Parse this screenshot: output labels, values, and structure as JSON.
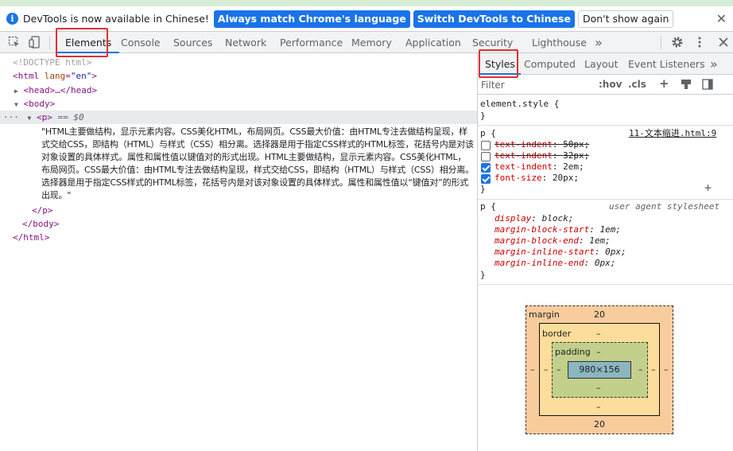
{
  "banner": {
    "message": "DevTools is now available in Chinese!",
    "match_language_label": "Always match Chrome's language",
    "switch_label": "Switch DevTools to Chinese",
    "dont_show_label": "Don't show again",
    "close_glyph": "✕"
  },
  "toolbar": {
    "tabs": [
      "Elements",
      "Console",
      "Sources",
      "Network",
      "Performance",
      "Memory",
      "Application",
      "Security",
      "Lighthouse"
    ],
    "more_glyph": "»",
    "active_tab": "Elements",
    "accent_color": "#1a73e8",
    "highlight_color": "#e03131"
  },
  "elements": {
    "doctype": "<!DOCTYPE html>",
    "html_open_tag": "<html",
    "html_attr_name": "lang",
    "html_attr_value": "\"en\"",
    "html_close_bracket": ">",
    "head_collapsed": "<head>…</head>",
    "body_open": "<body>",
    "p_open": "<p>",
    "selected_marker": "== $0",
    "p_text": "\"HTML主要做结构，显示元素内容。CSS美化HTML，布局网页。CSS最大价值：由HTML专注去做结构呈现，样式交给CSS，即结构（HTML）与样式（CSS）相分离。选择器是用于指定CSS样式的HTML标签，花括号内是对该对象设置的具体样式。属性和属性值以键值对的形式出现。HTML主要做结构，显示元素内容。CSS美化HTML，布局网页。CSS最大价值：由HTML专注去做结构呈现，样式交给CSS，即结构（HTML）与样式（CSS）相分离。选择器是用于指定CSS样式的HTML标签，花括号内是对该对象设置的具体样式。属性和属性值以“键值对”的形式出现。\"",
    "p_close": "</p>",
    "body_close": "</body>",
    "html_close": "</html>"
  },
  "styles_pane": {
    "tabs": [
      "Styles",
      "Computed",
      "Layout",
      "Event Listeners"
    ],
    "more_glyph": "»",
    "active_tab": "Styles",
    "filter_placeholder": "Filter",
    "hov_label": ":hov",
    "cls_label": ".cls",
    "plus_glyph": "+",
    "element_style": {
      "selector": "element.style {",
      "close": "}"
    },
    "author_rule": {
      "selector": "p {",
      "source": "11-文本缩进.html:9",
      "props": [
        {
          "name": "text-indent",
          "value": "50px",
          "checked": false,
          "struck": true
        },
        {
          "name": "text-indent",
          "value": "32px",
          "checked": false,
          "struck": true
        },
        {
          "name": "text-indent",
          "value": "2em",
          "checked": true,
          "struck": false
        },
        {
          "name": "font-size",
          "value": "20px",
          "checked": true,
          "struck": false
        }
      ],
      "close": "}"
    },
    "ua_rule": {
      "selector": "p {",
      "source": "user agent stylesheet",
      "props": [
        {
          "name": "display",
          "value": "block"
        },
        {
          "name": "margin-block-start",
          "value": "1em"
        },
        {
          "name": "margin-block-end",
          "value": "1em"
        },
        {
          "name": "margin-inline-start",
          "value": "0px"
        },
        {
          "name": "margin-inline-end",
          "value": "0px"
        }
      ],
      "close": "}"
    }
  },
  "box_model": {
    "margin_label": "margin",
    "margin_top": "20",
    "margin_bottom": "20",
    "margin_left": "–",
    "margin_right": "–",
    "border_label": "border",
    "border_top": "–",
    "border_bottom": "–",
    "border_left": "–",
    "border_right": "–",
    "padding_label": "padding",
    "padding_top": "–",
    "padding_bottom": "–",
    "padding_left": "–",
    "padding_right": "–",
    "content": "980×156",
    "colors": {
      "margin": "#f9cc9d",
      "border": "#fddd9b",
      "padding": "#c3d08b",
      "content": "#8cb6c0"
    }
  }
}
